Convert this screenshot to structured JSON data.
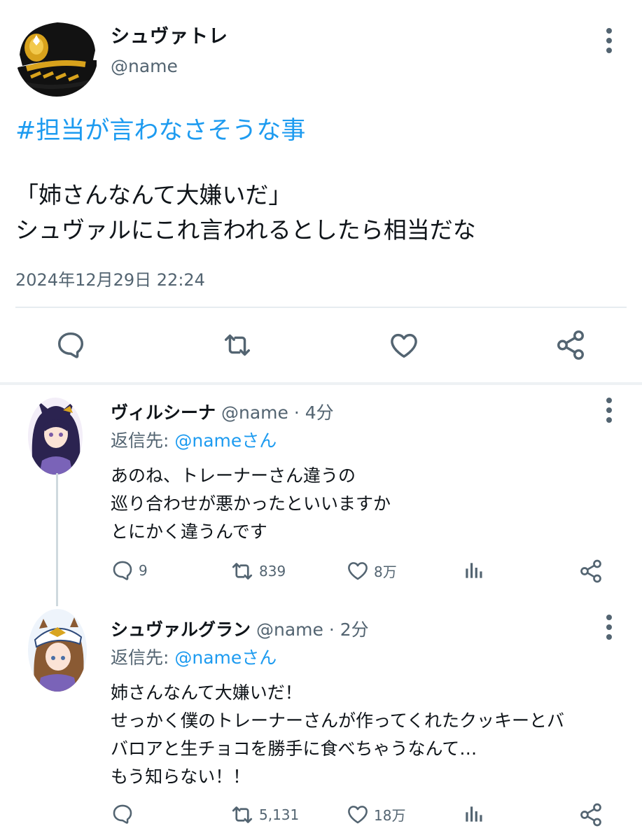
{
  "tweet": {
    "author_name": "シュヴァトレ",
    "author_handle": "@name",
    "hashtag": "#担当が言わなさそうな事",
    "lines": [
      "「姉さんなんて大嫌いだ」",
      "シュヴァルにこれ言われるとしたら相当だな"
    ],
    "timestamp": "2024年12月29日 22:24"
  },
  "replies": [
    {
      "name": "ヴィルシーナ",
      "meta": "@name · 4分",
      "reply_to_prefix": "返信先: ",
      "reply_to_mention": "@nameさん",
      "lines": [
        "あのね、トレーナーさん違うの",
        "巡り合わせが悪かったといいますか",
        "とにかく違うんです"
      ],
      "stats": {
        "replies": "9",
        "retweets": "839",
        "likes": "8万"
      }
    },
    {
      "name": "シュヴァルグラン",
      "meta": "@name · 2分",
      "reply_to_prefix": "返信先: ",
      "reply_to_mention": "@nameさん",
      "lines": [
        "姉さんなんて大嫌いだ！",
        "せっかく僕のトレーナーさんが作ってくれたクッキーとバ",
        "バロアと生チョコを勝手に食べちゃうなんて…",
        "もう知らない！！"
      ],
      "stats": {
        "replies": "",
        "retweets": "5,131",
        "likes": "18万"
      }
    }
  ],
  "icons": [
    "reply-icon",
    "retweet-icon",
    "like-icon",
    "share-icon",
    "more-icon",
    "views-icon"
  ],
  "colors": {
    "accent": "#1d9bf0",
    "muted": "#536471",
    "text": "#0f1419"
  }
}
